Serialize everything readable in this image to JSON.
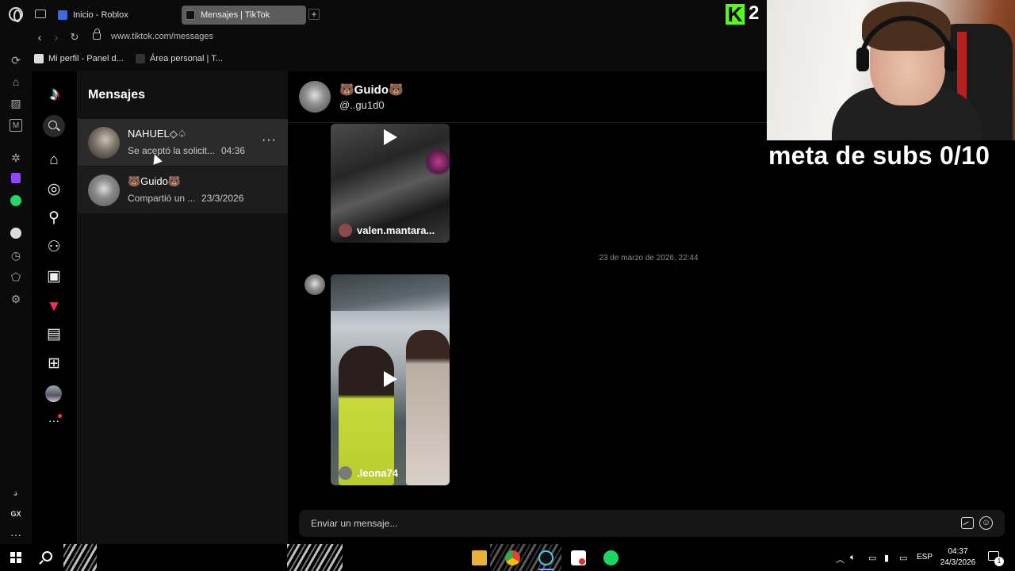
{
  "browser": {
    "tabs": [
      {
        "label": "Inicio - Roblox",
        "active": false
      },
      {
        "label": "Mensajes | TikTok",
        "active": true
      }
    ],
    "new_tab_label": "+",
    "url": "www.tiktok.com/messages",
    "bookmarks": [
      {
        "label": "Mi perfil - Panel d..."
      },
      {
        "label": "Área personal | T..."
      }
    ],
    "sidebar_icons": [
      "refresh-icon",
      "game-icon",
      "block-icon",
      "m-icon",
      "chatgpt-icon",
      "twitch-icon",
      "whatsapp-icon",
      "spotify-icon",
      "history-icon",
      "extensions-icon",
      "settings-icon",
      "feather-icon",
      "gx-icon",
      "more-icon"
    ],
    "sidebar_gx_label": "GX",
    "sidebar_more_label": "···"
  },
  "tiktok_nav": {
    "items": [
      "home-icon",
      "explore-icon",
      "following-icon",
      "friends-icon",
      "live-icon",
      "messages-icon",
      "inbox-icon",
      "upload-icon",
      "profile-icon",
      "more-icon"
    ],
    "more_label": "···",
    "accent_color": "#fe2c55"
  },
  "conversations": {
    "title": "Mensajes",
    "items": [
      {
        "name": "NAHUEL◇♤",
        "preview": "Se aceptó la solicit...",
        "time": "04:36",
        "menu": "···",
        "active": true
      },
      {
        "name": "🐻Guido🐻",
        "preview": "Compartió un ...",
        "time": "23/3/2026",
        "active": false
      }
    ]
  },
  "chat": {
    "contact_name": "🐻Guido🐻",
    "contact_handle": "@..gu1d0",
    "messages": [
      {
        "type": "shared-video",
        "author": "valen.mantara..."
      },
      {
        "type": "timestamp",
        "text": "23 de marzo de 2026, 22:44"
      },
      {
        "type": "shared-video",
        "author": ".leona74"
      }
    ],
    "input_placeholder": "Enviar un mensaje..."
  },
  "overlay": {
    "kick_logo": "K",
    "viewer_count": "2",
    "goal_text": "meta de subs 0/10",
    "kick_color": "#53fc18"
  },
  "taskbar": {
    "apps": [
      "file-explorer-icon",
      "chrome-icon",
      "opera-gx-icon",
      "roblox-icon",
      "spotify-icon"
    ],
    "language": "ESP",
    "time": "04:37",
    "date": "24/3/2026",
    "notification_count": "1"
  }
}
